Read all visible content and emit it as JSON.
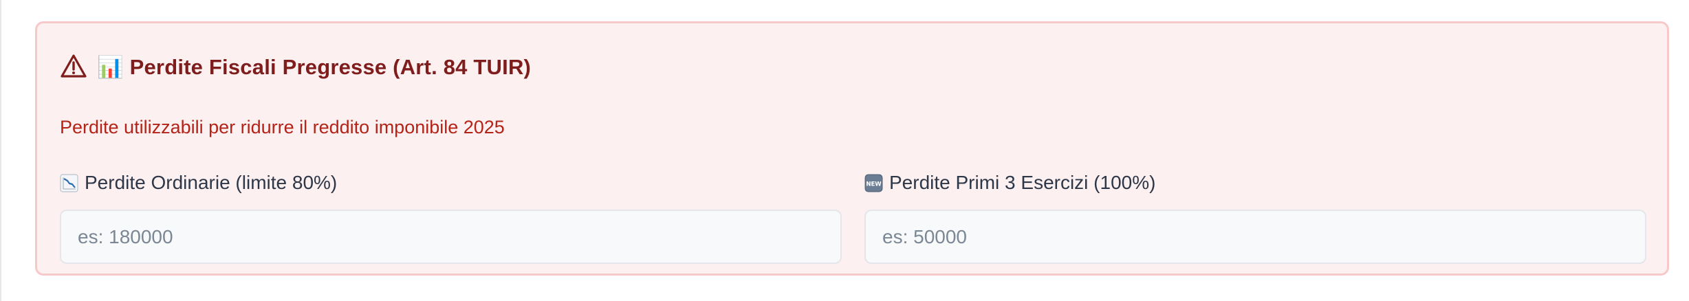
{
  "section": {
    "title": "📊 Perdite Fiscali Pregresse (Art. 84 TUIR)",
    "title_icons": [
      "warning-triangle-icon",
      "bar-chart-icon"
    ],
    "subtitle": "Perdite utilizzabili per ridurre il reddito imponibile 2025"
  },
  "fields": [
    {
      "label": "Perdite Ordinarie (limite 80%)",
      "icon": "chart-decreasing-icon",
      "value": "",
      "placeholder": "es: 180000"
    },
    {
      "label": "Perdite Primi 3 Esercizi (100%)",
      "icon": "new-badge-icon",
      "value": "",
      "placeholder": "es: 50000"
    }
  ],
  "colors": {
    "card_background": "#fdf0f0",
    "card_border": "#f6c9c9",
    "title": "#7f1d1d",
    "subtitle": "#b42318",
    "label": "#2d3748",
    "input_background": "#f8f9fa",
    "input_border": "#e3e6ea",
    "placeholder": "#7b8794"
  }
}
